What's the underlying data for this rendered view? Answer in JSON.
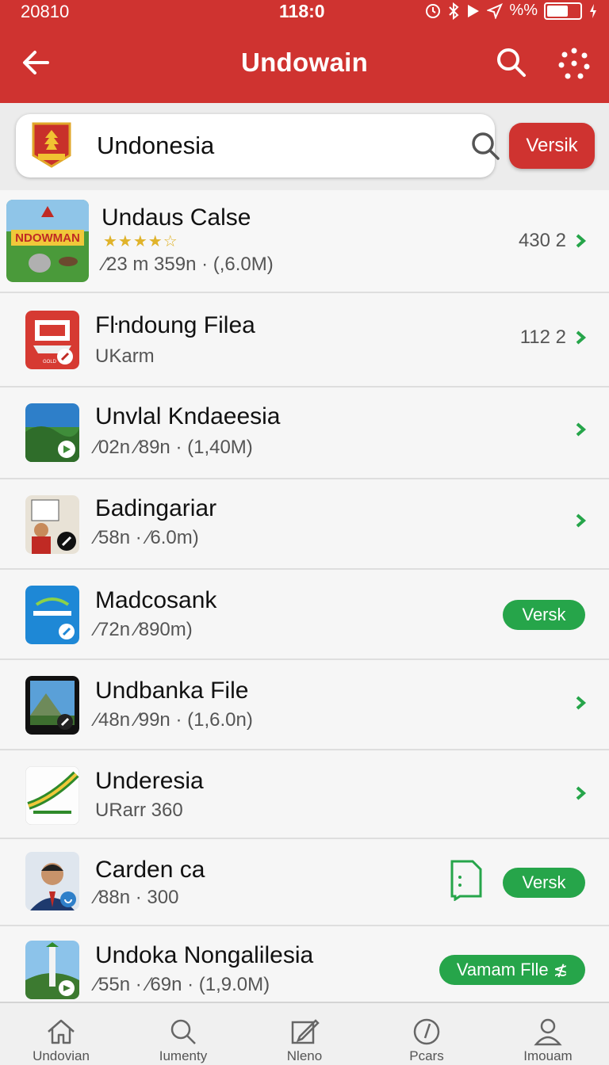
{
  "status": {
    "left": "20810",
    "time": "118:0",
    "battery_text": "%%"
  },
  "appbar": {
    "title": "Undowain",
    "back_icon": "arrow-left-icon",
    "search_icon": "search-icon",
    "more_icon": "dots-circle-icon"
  },
  "search": {
    "query": "Undonesia",
    "button_label": "Versik"
  },
  "colors": {
    "primary": "#cf3330",
    "accent_green": "#26a54a",
    "star": "#e0b32a"
  },
  "items": [
    {
      "title": "Undaus Calse",
      "meta": "⁄23 m  359n · (,6.0M)",
      "count": "430 2",
      "stars": "★★★★☆"
    },
    {
      "title": "Fŀndoung Filea",
      "meta": "UKarm",
      "count": "112 2"
    },
    {
      "title": "Unvlal Kndaeesia",
      "meta": "⁄02n  ⁄89n · (1,40M)"
    },
    {
      "title": "Бadingariar",
      "meta": "⁄58n · ⁄6.0m)"
    },
    {
      "title": "Madcosank",
      "meta": "⁄72n  ⁄890m)",
      "pill": "Versk"
    },
    {
      "title": "Undbanka File",
      "meta": "⁄48n  ⁄99n · (1,6.0n)"
    },
    {
      "title": "Underesia",
      "meta": "URarr  360"
    },
    {
      "title": "Carden ca",
      "meta": "⁄88n · 300",
      "pill": "Versk"
    },
    {
      "title": "Undoka Nongalilesia",
      "meta": "⁄55n · ⁄69n · (1,9.0M)",
      "pill": "Vamam Flle ≴"
    }
  ],
  "nav": [
    {
      "label": "Undovian",
      "icon": "home-icon"
    },
    {
      "label": "Iumenty",
      "icon": "search-icon"
    },
    {
      "label": "Nleno",
      "icon": "edit-icon"
    },
    {
      "label": "Pcars",
      "icon": "compass-icon"
    },
    {
      "label": "Imouam",
      "icon": "user-icon"
    }
  ]
}
